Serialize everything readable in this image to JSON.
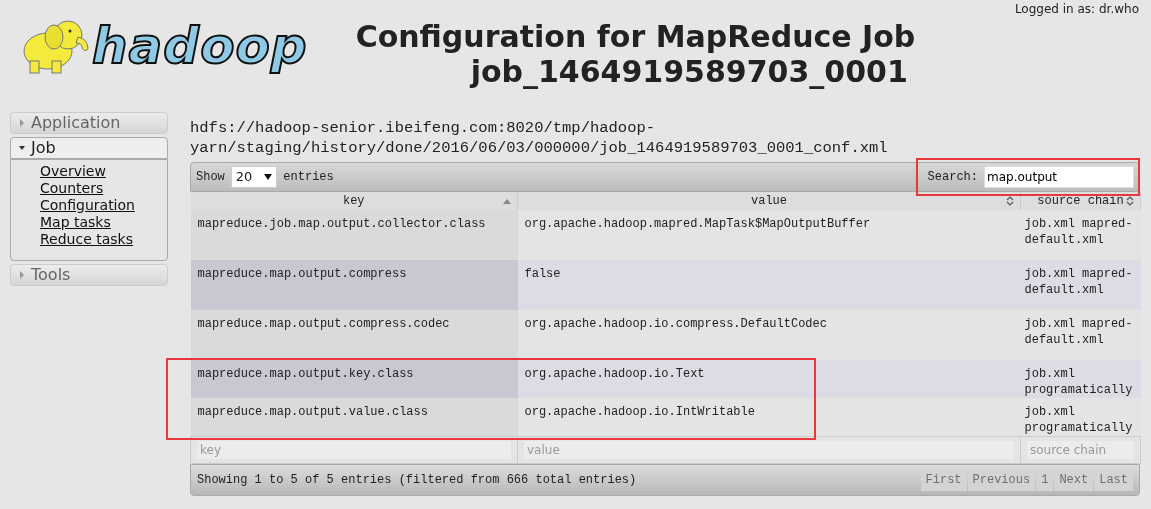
{
  "header": {
    "logged_in": "Logged in as: dr.who",
    "logo_text": "hadoop",
    "title_lines": [
      "Configuration for MapReduce Job",
      "job_1464919589703_0001"
    ]
  },
  "sidebar": [
    {
      "label": "Application",
      "expanded": false
    },
    {
      "label": "Job",
      "expanded": true,
      "items": [
        "Overview",
        "Counters",
        "Configuration",
        "Map tasks",
        "Reduce tasks"
      ]
    },
    {
      "label": "Tools",
      "expanded": false
    }
  ],
  "conf_path": "hdfs://hadoop-senior.ibeifeng.com:8020/tmp/hadoop-yarn/staging/history/done/2016/06/03/000000/job_1464919589703_0001_conf.xml",
  "table": {
    "length": {
      "label_before": "Show",
      "value": "20",
      "label_after": "entries"
    },
    "search": {
      "label": "Search:",
      "value": "map.output",
      "highlighted": true
    },
    "columns": [
      {
        "label": "key",
        "sorted": true
      },
      {
        "label": "value",
        "sorted": false
      },
      {
        "label": "source chain",
        "sorted": false
      }
    ],
    "rows": [
      {
        "key": "mapreduce.job.map.output.collector.class",
        "value": "org.apache.hadoop.mapred.MapTask$MapOutputBuffer",
        "source": "job.xml mapred-default.xml",
        "highlighted": false
      },
      {
        "key": "mapreduce.map.output.compress",
        "value": "false",
        "source": "job.xml mapred-default.xml",
        "highlighted": false
      },
      {
        "key": "mapreduce.map.output.compress.codec",
        "value": "org.apache.hadoop.io.compress.DefaultCodec",
        "source": "job.xml mapred-default.xml",
        "highlighted": false
      },
      {
        "key": "mapreduce.map.output.key.class",
        "value": "org.apache.hadoop.io.Text",
        "source": "job.xml programatically",
        "highlighted": true
      },
      {
        "key": "mapreduce.map.output.value.class",
        "value": "org.apache.hadoop.io.IntWritable",
        "source": "job.xml programatically",
        "highlighted": true
      }
    ],
    "filters": [
      {
        "placeholder": "key"
      },
      {
        "placeholder": "value"
      },
      {
        "placeholder": "source chain"
      }
    ],
    "info": "Showing 1 to 5 of 5 entries (filtered from 666 total entries)",
    "pagination": [
      {
        "label": "First",
        "disabled": true
      },
      {
        "label": "Previous",
        "disabled": true
      },
      {
        "label": "1",
        "disabled": true
      },
      {
        "label": "Next",
        "disabled": true
      },
      {
        "label": "Last",
        "disabled": true
      }
    ]
  }
}
